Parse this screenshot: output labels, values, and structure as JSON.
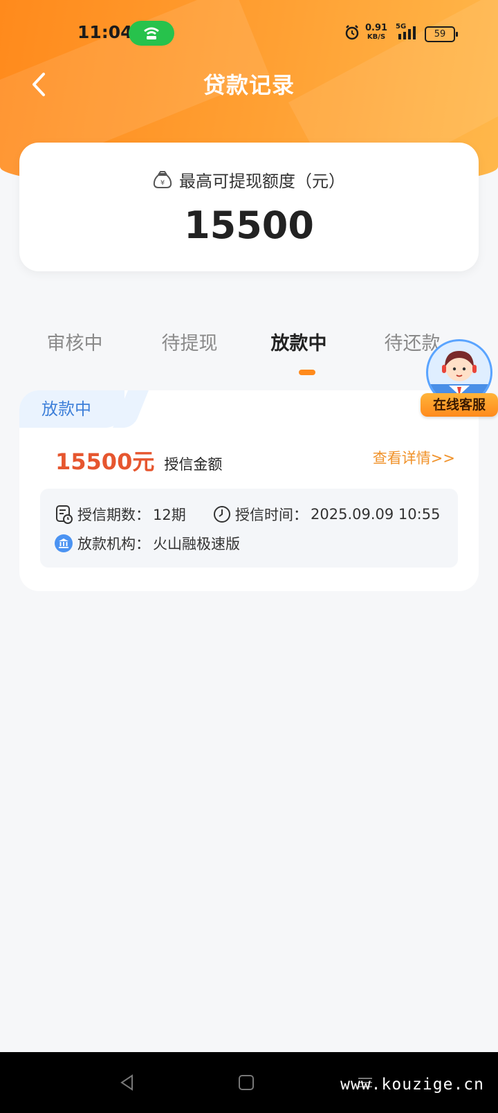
{
  "status_bar": {
    "time": "11:04",
    "net_speed": "0.91",
    "net_unit": "KB/S",
    "network": "5G",
    "battery": "59"
  },
  "header": {
    "title": "贷款记录"
  },
  "quota": {
    "label": "最高可提现额度（元）",
    "value": "15500"
  },
  "tabs": [
    {
      "label": "审核中"
    },
    {
      "label": "待提现"
    },
    {
      "label": "放款中",
      "active": true
    },
    {
      "label": "待还款"
    }
  ],
  "record": {
    "status": "放款中",
    "amount": "15500元",
    "amount_label": "授信金额",
    "detail_link": "查看详情>>",
    "period_label": "授信期数：",
    "period_value": "12期",
    "time_label": "授信时间：",
    "time_value": "2025.09.09 10:55",
    "institution_label": "放款机构：",
    "institution_value": "火山融极速版"
  },
  "service": {
    "label": "在线客服"
  },
  "watermark": "www.kouzige.cn",
  "colors": {
    "accent": "#ff8a1c",
    "amount": "#e6562f",
    "link": "#f0922a",
    "tag": "#3d7fd9"
  }
}
